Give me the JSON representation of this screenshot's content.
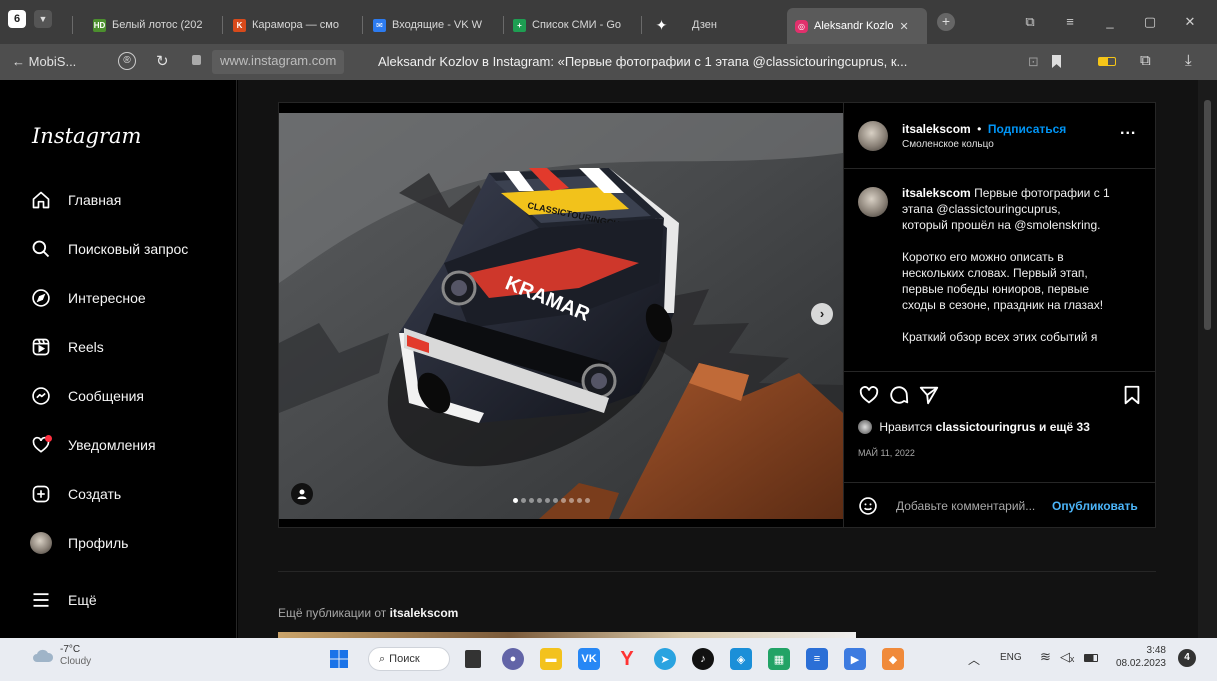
{
  "browser": {
    "tab_count": "6",
    "tabs": [
      {
        "label": "Белый лотос (202",
        "favicon": "HD",
        "color": "#4c8f2e"
      },
      {
        "label": "Карамора — смо",
        "favicon": "K",
        "color": "#d84a1b"
      },
      {
        "label": "Входящие - VK W",
        "favicon": "✉",
        "color": "#2c7bf0"
      },
      {
        "label": "Список СМИ - Go",
        "favicon": "+",
        "color": "#1e9e52"
      },
      {
        "label": "Дзен",
        "favicon": "✦",
        "color": "#3c3c3c"
      },
      {
        "label": "Aleksandr Kozlo",
        "favicon": "◎",
        "color": "#e1306c"
      }
    ],
    "back_label": "← MobiS...",
    "url": "www.instagram.com",
    "page_title": "Aleksandr Kozlov в Instagram: «Первые фотографии с 1 этапа @classictouringcuprus, к..."
  },
  "sidebar": {
    "logo": "Instagram",
    "items": [
      {
        "label": "Главная",
        "icon": "home-icon"
      },
      {
        "label": "Поисковый запрос",
        "icon": "search-icon"
      },
      {
        "label": "Интересное",
        "icon": "compass-icon"
      },
      {
        "label": "Reels",
        "icon": "reels-icon"
      },
      {
        "label": "Сообщения",
        "icon": "messenger-icon"
      },
      {
        "label": "Уведомления",
        "icon": "heart-icon"
      },
      {
        "label": "Создать",
        "icon": "plus-square-icon"
      },
      {
        "label": "Профиль",
        "icon": "avatar"
      },
      {
        "label": "Ещё",
        "icon": "menu-icon"
      }
    ]
  },
  "post": {
    "username": "itsalekscom",
    "dot": "•",
    "follow_label": "Подписаться",
    "location": "Смоленское кольцо",
    "more_label": "...",
    "caption_user": "itsalekscom",
    "caption_lines_1": [
      "Первые фотографии с 1",
      "этапа @classictouringcuprus,",
      "который прошёл на @smolenskring."
    ],
    "caption_lines_2": [
      "Коротко его можно описать в",
      "нескольких словах. Первый этап,",
      "первые победы юниоров, первые",
      "сходы в сезоне, праздник на глазах!"
    ],
    "caption_lines_3": [
      "Краткий обзор всех этих событий я"
    ],
    "likes_prefix": "Нравится",
    "likes_user": "classictouringrus",
    "likes_suffix": "и ещё 33",
    "date": "МАЙ 11, 2022",
    "comment_placeholder": "Добавьте комментарий...",
    "publish_label": "Опубликовать",
    "carousel_total": 10,
    "carousel_active": 1,
    "car_hood_text": "KRAMAR",
    "car_windshield_text": "CLASSICTOURINGCUP"
  },
  "more_posts": {
    "prefix": "Ещё публикации от",
    "user": "itsalekscom"
  },
  "taskbar": {
    "temp": "-7°C",
    "weather": "Cloudy",
    "search_label": "Поиск",
    "lang": "ENG",
    "time": "3:48",
    "date": "08.02.2023",
    "notif_count": "4"
  }
}
